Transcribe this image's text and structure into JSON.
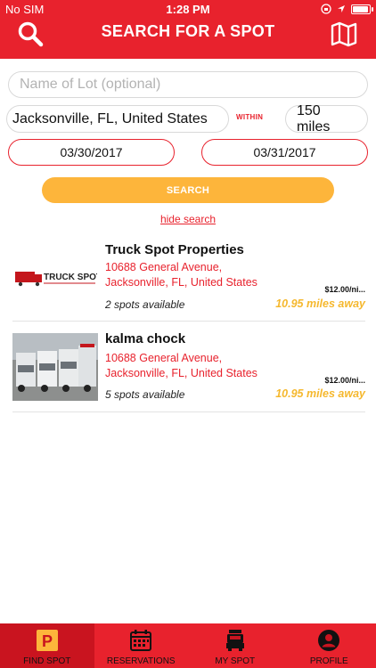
{
  "status": {
    "carrier": "No SIM",
    "time": "1:28 PM"
  },
  "header": {
    "title": "SEARCH FOR A SPOT"
  },
  "form": {
    "lot_placeholder": "Name of Lot (optional)",
    "city": "Jacksonville, FL, United States",
    "within_label": "WITHIN",
    "distance": "150 miles",
    "date_from": "03/30/2017",
    "date_to": "03/31/2017",
    "search_label": "SEARCH",
    "hide_search_label": "hide search"
  },
  "results": [
    {
      "name": "Truck Spot Properties",
      "address_line1": "10688 General Avenue,",
      "address_line2": "Jacksonville, FL, United States",
      "price": "$12.00/ni...",
      "spots": "2 spots available",
      "distance": "10.95 miles away",
      "logo_text": "TRUCK SPOT"
    },
    {
      "name": "kalma chock",
      "address_line1": "10688 General Avenue,",
      "address_line2": "Jacksonville, FL, United States",
      "price": "$12.00/ni...",
      "spots": "5 spots available",
      "distance": "10.95 miles away"
    }
  ],
  "tabs": [
    {
      "label": "FIND SPOT",
      "icon": "parking-icon",
      "active": true
    },
    {
      "label": "RESERVATIONS",
      "icon": "calendar-icon",
      "active": false
    },
    {
      "label": "MY SPOT",
      "icon": "truck-icon",
      "active": false
    },
    {
      "label": "PROFILE",
      "icon": "user-icon",
      "active": false
    }
  ],
  "colors": {
    "brand_red": "#e8222d",
    "accent_yellow": "#fdb53b",
    "distance_yellow": "#f5b82e"
  }
}
